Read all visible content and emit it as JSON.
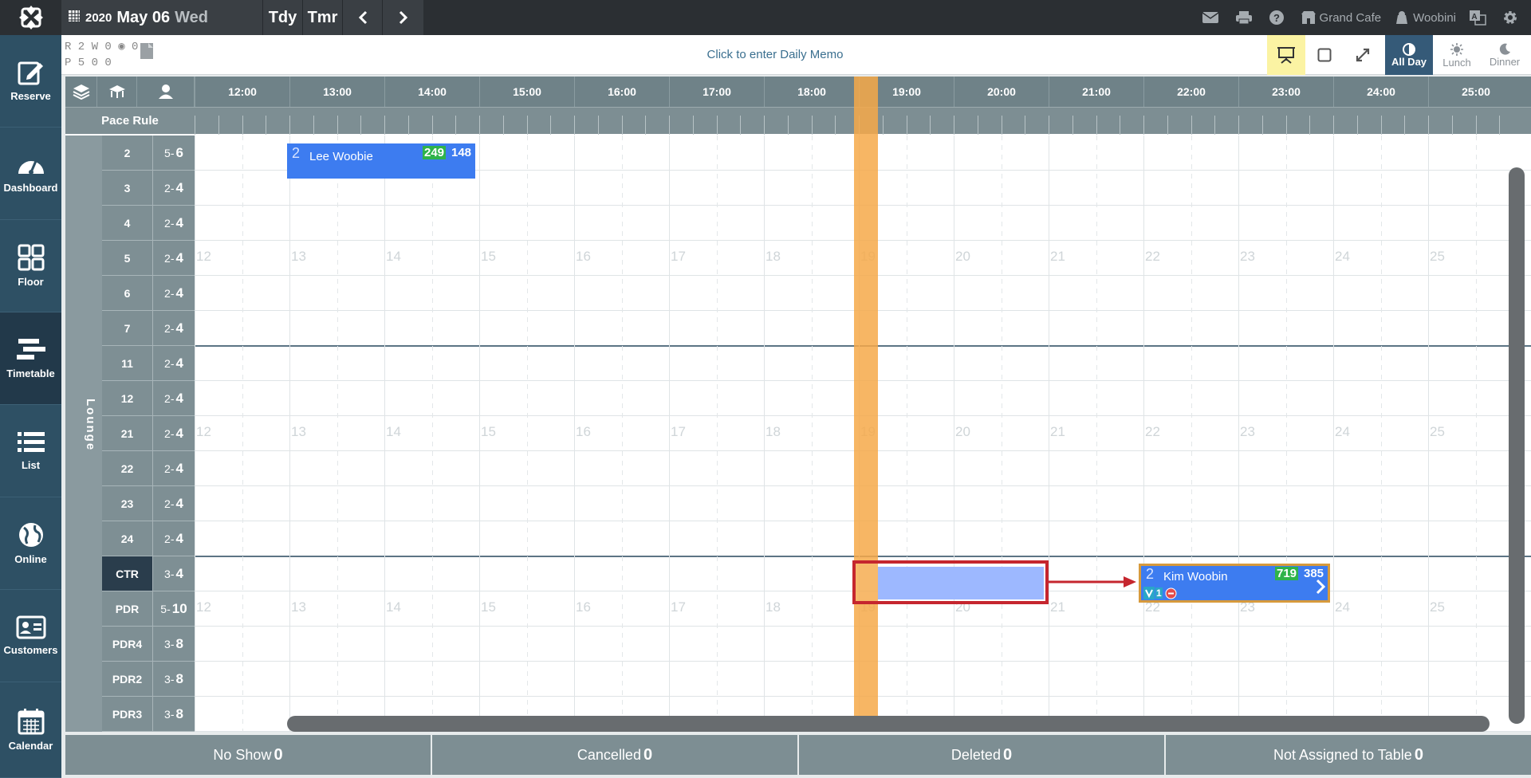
{
  "header": {
    "year": "2020",
    "month_day": "May 06",
    "weekday": "Wed",
    "today_label": "Tdy",
    "tomorrow_label": "Tmr",
    "store_name": "Grand Cafe",
    "user_name": "Woobini"
  },
  "sidebar": {
    "items": [
      {
        "label": "Reserve",
        "icon": "reserve-icon"
      },
      {
        "label": "Dashboard",
        "icon": "dashboard-icon"
      },
      {
        "label": "Floor",
        "icon": "floor-icon"
      },
      {
        "label": "Timetable",
        "icon": "timetable-icon"
      },
      {
        "label": "List",
        "icon": "list-icon"
      },
      {
        "label": "Online",
        "icon": "globe-icon"
      },
      {
        "label": "Customers",
        "icon": "customer-card-icon"
      },
      {
        "label": "Calendar",
        "icon": "calendar-icon"
      }
    ],
    "active": "Timetable"
  },
  "stats": {
    "row1": "R 2 W 0 ◉ 0",
    "row2": "P 5   0   0"
  },
  "memo": "Click to enter Daily Memo",
  "memo_badge": "0",
  "meals": [
    {
      "label": "All Day",
      "active": true
    },
    {
      "label": "Lunch",
      "active": false
    },
    {
      "label": "Dinner",
      "active": false
    }
  ],
  "hours": [
    "12:00",
    "13:00",
    "14:00",
    "15:00",
    "16:00",
    "17:00",
    "18:00",
    "19:00",
    "20:00",
    "21:00",
    "22:00",
    "23:00",
    "24:00",
    "25:00"
  ],
  "pace_rule_label": "Pace Rule",
  "section_label": "Lounge",
  "watermark_hours": [
    "12",
    "13",
    "14",
    "15",
    "16",
    "17",
    "18",
    "19",
    "20",
    "21",
    "22",
    "23",
    "24",
    "25"
  ],
  "tables": [
    {
      "name": "2",
      "min": "5",
      "max": "6"
    },
    {
      "name": "3",
      "min": "2",
      "max": "4"
    },
    {
      "name": "4",
      "min": "2",
      "max": "4"
    },
    {
      "name": "5",
      "min": "2",
      "max": "4"
    },
    {
      "name": "6",
      "min": "2",
      "max": "4"
    },
    {
      "name": "7",
      "min": "2",
      "max": "4"
    },
    {
      "name": "11",
      "min": "2",
      "max": "4"
    },
    {
      "name": "12",
      "min": "2",
      "max": "4"
    },
    {
      "name": "21",
      "min": "2",
      "max": "4"
    },
    {
      "name": "22",
      "min": "2",
      "max": "4"
    },
    {
      "name": "23",
      "min": "2",
      "max": "4"
    },
    {
      "name": "24",
      "min": "2",
      "max": "4"
    },
    {
      "name": "CTR",
      "min": "3",
      "max": "4"
    },
    {
      "name": "PDR",
      "min": "5",
      "max": "10"
    },
    {
      "name": "PDR4",
      "min": "3",
      "max": "8"
    },
    {
      "name": "PDR2",
      "min": "3",
      "max": "8"
    },
    {
      "name": "PDR3",
      "min": "3",
      "max": "8"
    }
  ],
  "reservations": [
    {
      "party": "2",
      "name": "Lee Woobie",
      "num1": "249",
      "num2": "148"
    },
    {
      "party": "2",
      "name": "Kim Woobin",
      "num1": "719",
      "num2": "385",
      "tag": "1"
    }
  ],
  "footer": {
    "no_show_label": "No Show",
    "no_show_count": "0",
    "cancelled_label": "Cancelled",
    "cancelled_count": "0",
    "deleted_label": "Deleted",
    "deleted_count": "0",
    "unassigned_label": "Not Assigned to Table",
    "unassigned_count": "0"
  }
}
